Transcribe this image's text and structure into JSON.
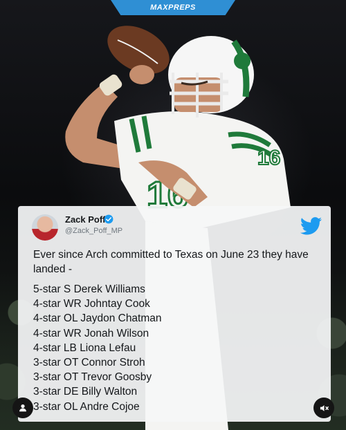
{
  "brand": {
    "logo_text": "MAXPREPS"
  },
  "photo": {
    "jersey_number": "16"
  },
  "tweet": {
    "author_name": "Zack Poff",
    "author_handle": "@Zack_Poff_MP",
    "text": "Ever since Arch committed to Texas on June 23 they have landed -",
    "commits": [
      "5-star S Derek Williams",
      "4-star WR Johntay Cook",
      "4-star OL Jaydon Chatman",
      "4-star WR Jonah Wilson",
      "4-star LB Liona Lefau",
      "3-star OT Connor Stroh",
      "3-star OT Trevor Goosby",
      "3-star DE Billy Walton",
      "3-star OL Andre Cojoe"
    ]
  },
  "icons": {
    "verified": "verified-badge-icon",
    "platform": "twitter-bird-icon",
    "user": "user-tag-icon",
    "mute": "speaker-muted-icon"
  },
  "colors": {
    "brand_blue": "#2f8fd4",
    "jersey_green": "#1f7a3a",
    "twitter_blue": "#1d9bf0"
  }
}
